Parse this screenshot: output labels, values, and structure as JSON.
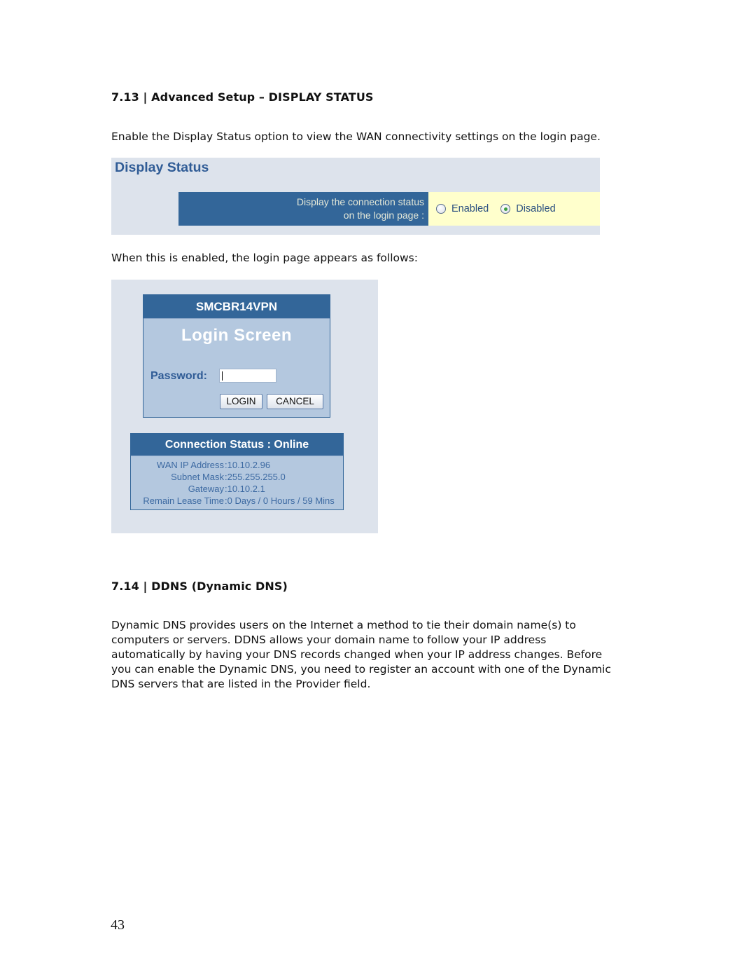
{
  "section_713": {
    "heading": "7.13 | Advanced Setup – DISPLAY STATUS",
    "intro": "Enable the Display Status option to view the WAN connectivity settings on the login page."
  },
  "display_status_panel": {
    "title": "Display Status",
    "label_line1": "Display the connection status",
    "label_line2": "on the login page :",
    "options": [
      {
        "label": "Enabled",
        "selected": false
      },
      {
        "label": "Disabled",
        "selected": true
      }
    ]
  },
  "login_caption": "When this is enabled, the login page appears as follows:",
  "login_screen": {
    "device_name": "SMCBR14VPN",
    "title": "Login  Screen",
    "password_label": "Password:",
    "password_value": "",
    "login_button": "LOGIN",
    "cancel_button": "CANCEL"
  },
  "connection_status": {
    "header": "Connection Status : Online",
    "rows": [
      {
        "label": "WAN IP Address",
        "value": ":10.10.2.96"
      },
      {
        "label": "Subnet Mask",
        "value": ":255.255.255.0"
      },
      {
        "label": "Gateway",
        "value": ":10.10.2.1"
      },
      {
        "label": "Remain Lease Time",
        "value": ":0 Days / 0 Hours / 59 Mins"
      }
    ]
  },
  "section_714": {
    "heading": "7.14 | DDNS (Dynamic DNS)",
    "lines": [
      "Dynamic DNS provides users on the Internet a method to tie their domain name(s) to",
      "computers or servers. DDNS allows your domain name to follow your IP address",
      "automatically by having your DNS records changed when your IP address changes. Before",
      "you can enable the Dynamic DNS, you need to register an account with one of the Dynamic",
      "DNS servers that are listed in the Provider field."
    ]
  },
  "page_number": "43",
  "colors": {
    "panel_bg": "#dde3ec",
    "header_blue": "#336699",
    "option_bg": "#ffffcc",
    "login_body": "#b4c8df"
  }
}
